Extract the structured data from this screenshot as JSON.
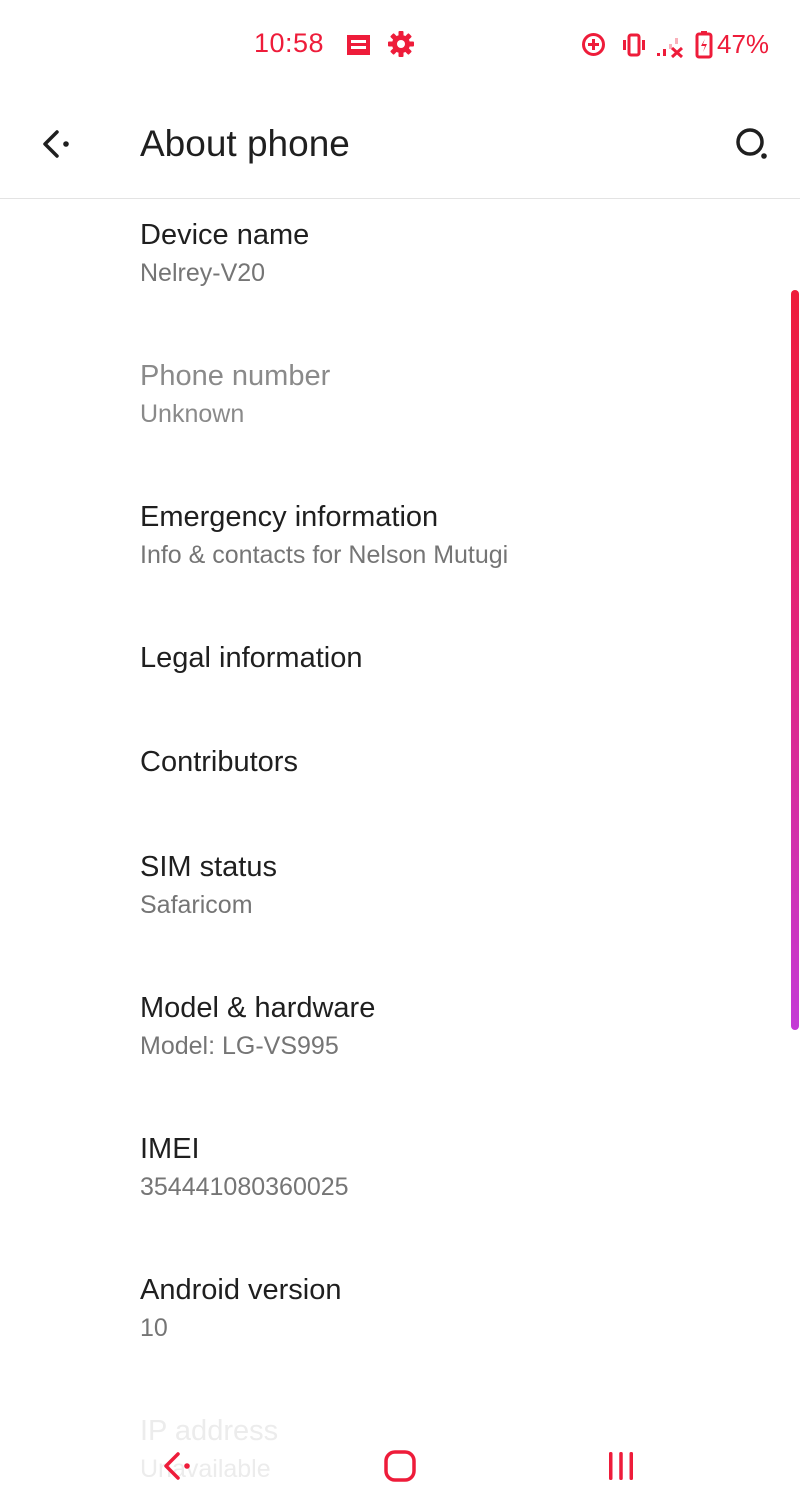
{
  "status_bar": {
    "time": "10:58",
    "battery_percent": "47%",
    "accent_color": "#ee1c3a",
    "icons": [
      "message-icon",
      "settings-gear-icon",
      "data-saver-icon",
      "vibrate-icon",
      "signal-no-service-icon",
      "battery-icon"
    ]
  },
  "app_bar": {
    "title": "About phone",
    "back_icon": "back-arrow-icon",
    "search_icon": "search-icon"
  },
  "items": [
    {
      "title": "Device name",
      "summary": "Nelrey-V20"
    },
    {
      "title": "Phone number",
      "summary": "Unknown"
    },
    {
      "title": "Emergency information",
      "summary": "Info & contacts for Nelson Mutugi"
    },
    {
      "title": "Legal information",
      "summary": ""
    },
    {
      "title": "Contributors",
      "summary": ""
    },
    {
      "title": "SIM status",
      "summary": "Safaricom"
    },
    {
      "title": "Model & hardware",
      "summary": "Model: LG-VS995"
    },
    {
      "title": "IMEI",
      "summary": "354441080360025"
    },
    {
      "title": "Android version",
      "summary": "10"
    },
    {
      "title": "IP address",
      "summary": "Unavailable"
    }
  ],
  "nav_bar": {
    "icons": [
      "nav-back-icon",
      "nav-home-icon",
      "nav-recents-icon"
    ],
    "color": "#ee1c3a"
  }
}
